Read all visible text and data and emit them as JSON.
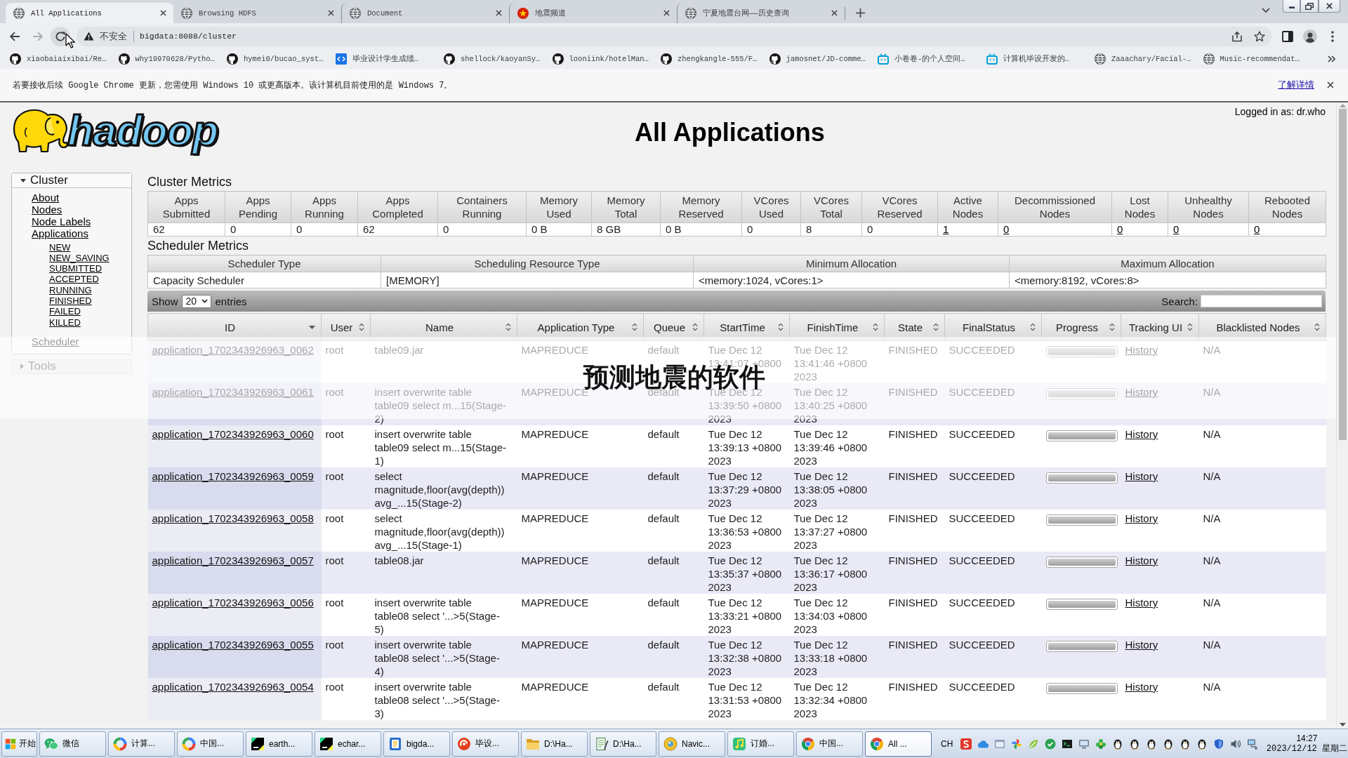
{
  "browser": {
    "tabs": [
      {
        "title": "All Applications",
        "kind": "web",
        "selected": true
      },
      {
        "title": "Browsing HDFS",
        "kind": "web",
        "selected": false
      },
      {
        "title": "Document",
        "kind": "web",
        "selected": false
      },
      {
        "title": "地震频道",
        "kind": "emblem",
        "selected": false
      },
      {
        "title": "宁夏地震台网——历史查询",
        "kind": "web",
        "selected": false
      }
    ],
    "address_bar": {
      "security": "不安全",
      "url": "bigdata:8088/cluster"
    },
    "bookmarks": [
      {
        "title": "xiaobaiaixibai/Re…",
        "kind": "repo"
      },
      {
        "title": "why19970628/Pytho…",
        "kind": "repo"
      },
      {
        "title": "hymei0/bucao_syst…",
        "kind": "repo"
      },
      {
        "title": "毕业设计学生成绩…",
        "kind": "code"
      },
      {
        "title": "shellock/kaoyanSy…",
        "kind": "repo"
      },
      {
        "title": "looniink/hotelMan…",
        "kind": "repo"
      },
      {
        "title": "zhengkangle-555/F…",
        "kind": "repo"
      },
      {
        "title": "jamosnet/JD-comme…",
        "kind": "repo"
      },
      {
        "title": "小卷卷-的个人空间…",
        "kind": "video"
      },
      {
        "title": "计算机毕设开发的…",
        "kind": "video"
      },
      {
        "title": "Zaaachary/Facial-…",
        "kind": "web"
      },
      {
        "title": "Music-recommendat…",
        "kind": "web"
      }
    ],
    "info_bar": {
      "message": "若要接收后续 Google Chrome 更新，您需使用 Windows 10 或更高版本。该计算机目前使用的是 Windows 7。",
      "link": "了解详情"
    }
  },
  "page": {
    "logo": "hadoop",
    "title": "All Applications",
    "login": "Logged in as: dr.who",
    "nav": [
      {
        "label": "Cluster",
        "expanded": true,
        "items": [
          {
            "label": "About"
          },
          {
            "label": "Nodes"
          },
          {
            "label": "Node Labels"
          },
          {
            "label": "Applications",
            "children": [
              {
                "label": "NEW"
              },
              {
                "label": "NEW_SAVING"
              },
              {
                "label": "SUBMITTED"
              },
              {
                "label": "ACCEPTED"
              },
              {
                "label": "RUNNING"
              },
              {
                "label": "FINISHED"
              },
              {
                "label": "FAILED"
              },
              {
                "label": "KILLED"
              }
            ]
          },
          {
            "label": "Scheduler"
          }
        ]
      },
      {
        "label": "Tools",
        "expanded": false
      }
    ],
    "cluster_metrics": {
      "title": "Cluster Metrics",
      "columns": [
        "Apps Submitted",
        "Apps Pending",
        "Apps Running",
        "Apps Completed",
        "Containers Running",
        "Memory Used",
        "Memory Total",
        "Memory Reserved",
        "VCores Used",
        "VCores Total",
        "VCores Reserved",
        "Active Nodes",
        "Decommissioned Nodes",
        "Lost Nodes",
        "Unhealthy Nodes",
        "Rebooted Nodes"
      ],
      "values": [
        {
          "text": "62",
          "link": false
        },
        {
          "text": "0",
          "link": false
        },
        {
          "text": "0",
          "link": false
        },
        {
          "text": "62",
          "link": false
        },
        {
          "text": "0",
          "link": false
        },
        {
          "text": "0 B",
          "link": false
        },
        {
          "text": "8 GB",
          "link": false
        },
        {
          "text": "0 B",
          "link": false
        },
        {
          "text": "0",
          "link": false
        },
        {
          "text": "8",
          "link": false
        },
        {
          "text": "0",
          "link": false
        },
        {
          "text": "1",
          "link": true
        },
        {
          "text": "0",
          "link": true
        },
        {
          "text": "0",
          "link": true
        },
        {
          "text": "0",
          "link": true
        },
        {
          "text": "0",
          "link": true
        }
      ]
    },
    "scheduler_metrics": {
      "title": "Scheduler Metrics",
      "columns": [
        "Scheduler Type",
        "Scheduling Resource Type",
        "Minimum Allocation",
        "Maximum Allocation"
      ],
      "values": [
        "Capacity Scheduler",
        "[MEMORY]",
        "<memory:1024, vCores:1>",
        "<memory:8192, vCores:8>"
      ]
    },
    "applications": {
      "show_label": "Show",
      "page_size": "20",
      "entries_label": "entries",
      "search_label": "Search:",
      "columns": [
        {
          "label": "ID",
          "sorted": true
        },
        {
          "label": "User",
          "sorted": false
        },
        {
          "label": "Name",
          "sorted": false
        },
        {
          "label": "Application Type",
          "sorted": false
        },
        {
          "label": "Queue",
          "sorted": false
        },
        {
          "label": "StartTime",
          "sorted": false
        },
        {
          "label": "FinishTime",
          "sorted": false
        },
        {
          "label": "State",
          "sorted": false
        },
        {
          "label": "FinalStatus",
          "sorted": false
        },
        {
          "label": "Progress",
          "sorted": false
        },
        {
          "label": "Tracking UI",
          "sorted": false
        },
        {
          "label": "Blacklisted Nodes",
          "sorted": false
        }
      ],
      "rows": [
        {
          "id": "application_1702343926963_0062",
          "user": "root",
          "name": "table09.jar",
          "type": "MAPREDUCE",
          "queue": "default",
          "start": "Tue Dec 12 13:41:07 +0800",
          "finish": "Tue Dec 12 13:41:46 +0800 2023",
          "state": "FINISHED",
          "final_status": "SUCCEEDED",
          "level": 1,
          "tracking": "History",
          "blacklisted": "N/A"
        },
        {
          "id": "application_1702343926963_0061",
          "user": "root",
          "name": "insert overwrite table table09 select m...15(Stage-2)",
          "type": "MAPREDUCE",
          "queue": "default",
          "start": "Tue Dec 12 13:39:50 +0800 2023",
          "finish": "Tue Dec 12 13:40:25 +0800 2023",
          "state": "FINISHED",
          "final_status": "SUCCEEDED",
          "level": 1,
          "tracking": "History",
          "blacklisted": "N/A"
        },
        {
          "id": "application_1702343926963_0060",
          "user": "root",
          "name": "insert overwrite table table09 select m...15(Stage-1)",
          "type": "MAPREDUCE",
          "queue": "default",
          "start": "Tue Dec 12 13:39:13 +0800 2023",
          "finish": "Tue Dec 12 13:39:46 +0800 2023",
          "state": "FINISHED",
          "final_status": "SUCCEEDED",
          "level": 1,
          "tracking": "History",
          "blacklisted": "N/A"
        },
        {
          "id": "application_1702343926963_0059",
          "user": "root",
          "name": "select magnitude,floor(avg(depth)) avg_...15(Stage-2)",
          "type": "MAPREDUCE",
          "queue": "default",
          "start": "Tue Dec 12 13:37:29 +0800 2023",
          "finish": "Tue Dec 12 13:38:05 +0800 2023",
          "state": "FINISHED",
          "final_status": "SUCCEEDED",
          "level": 1,
          "tracking": "History",
          "blacklisted": "N/A"
        },
        {
          "id": "application_1702343926963_0058",
          "user": "root",
          "name": "select magnitude,floor(avg(depth)) avg_...15(Stage-1)",
          "type": "MAPREDUCE",
          "queue": "default",
          "start": "Tue Dec 12 13:36:53 +0800 2023",
          "finish": "Tue Dec 12 13:37:27 +0800 2023",
          "state": "FINISHED",
          "final_status": "SUCCEEDED",
          "level": 1,
          "tracking": "History",
          "blacklisted": "N/A"
        },
        {
          "id": "application_1702343926963_0057",
          "user": "root",
          "name": "table08.jar",
          "type": "MAPREDUCE",
          "queue": "default",
          "start": "Tue Dec 12 13:35:37 +0800 2023",
          "finish": "Tue Dec 12 13:36:17 +0800 2023",
          "state": "FINISHED",
          "final_status": "SUCCEEDED",
          "level": 1,
          "tracking": "History",
          "blacklisted": "N/A"
        },
        {
          "id": "application_1702343926963_0056",
          "user": "root",
          "name": "insert overwrite table table08 select '...>5(Stage-5)",
          "type": "MAPREDUCE",
          "queue": "default",
          "start": "Tue Dec 12 13:33:21 +0800 2023",
          "finish": "Tue Dec 12 13:34:03 +0800 2023",
          "state": "FINISHED",
          "final_status": "SUCCEEDED",
          "level": 1,
          "tracking": "History",
          "blacklisted": "N/A"
        },
        {
          "id": "application_1702343926963_0055",
          "user": "root",
          "name": "insert overwrite table table08 select '...>5(Stage-4)",
          "type": "MAPREDUCE",
          "queue": "default",
          "start": "Tue Dec 12 13:32:38 +0800 2023",
          "finish": "Tue Dec 12 13:33:18 +0800 2023",
          "state": "FINISHED",
          "final_status": "SUCCEEDED",
          "level": 1,
          "tracking": "History",
          "blacklisted": "N/A"
        },
        {
          "id": "application_1702343926963_0054",
          "user": "root",
          "name": "insert overwrite table table08 select '...>5(Stage-3)",
          "type": "MAPREDUCE",
          "queue": "default",
          "start": "Tue Dec 12 13:31:53 +0800 2023",
          "finish": "Tue Dec 12 13:32:34 +0800 2023",
          "state": "FINISHED",
          "final_status": "SUCCEEDED",
          "level": 1,
          "tracking": "History",
          "blacklisted": "N/A"
        }
      ]
    }
  },
  "overlay_caption": "预测地震的软件",
  "taskbar": {
    "start": "开始",
    "items": [
      {
        "label": "微信",
        "kind": "chat",
        "selected": false
      },
      {
        "label": "计算...",
        "kind": "ring",
        "selected": false
      },
      {
        "label": "中国...",
        "kind": "ring",
        "selected": false
      },
      {
        "label": "earth...",
        "kind": "ide",
        "selected": false
      },
      {
        "label": "echar...",
        "kind": "ide",
        "selected": false
      },
      {
        "label": "bigda...",
        "kind": "tablet",
        "selected": false
      },
      {
        "label": "毕设...",
        "kind": "swirl",
        "selected": false
      },
      {
        "label": "D:\\Ha...",
        "kind": "folder",
        "selected": false
      },
      {
        "label": "D:\\Ha...",
        "kind": "notepad",
        "selected": false
      },
      {
        "label": "Navic...",
        "kind": "disc",
        "selected": false
      },
      {
        "label": "订婚...",
        "kind": "music",
        "selected": false
      },
      {
        "label": "中国...",
        "kind": "segments",
        "selected": false
      },
      {
        "label": "All ...",
        "kind": "segments",
        "selected": true
      }
    ],
    "language": "CH",
    "time": "14:27",
    "date": "2023/12/12 星期二"
  }
}
